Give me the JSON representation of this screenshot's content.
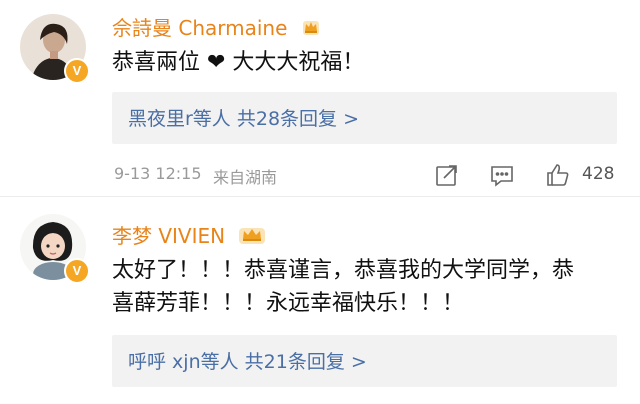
{
  "comments": [
    {
      "user": "佘詩曼 Charmaine",
      "badge": "V",
      "text": "恭喜兩位 ❤ 大大大祝福！",
      "replies": "黑夜里r等人 共28条回复 >",
      "time": "9-13 12:15",
      "location": "来自湖南",
      "likes": "428"
    },
    {
      "user": "李梦 VIVIEN",
      "badge": "V",
      "text_line1": "太好了！！！恭喜谨言，恭喜我的大学同学，恭",
      "text_line2": "喜薛芳菲！！！永远幸福快乐！！！",
      "replies": "呼呼 xjn等人 共21条回复 >"
    }
  ],
  "icons": {
    "share": "share-icon",
    "comment": "comment-icon",
    "like": "like-icon",
    "crown": "crown-icon"
  },
  "colors": {
    "name": "#e8841a",
    "link": "#4a6fa5",
    "badge": "#f5a623"
  }
}
